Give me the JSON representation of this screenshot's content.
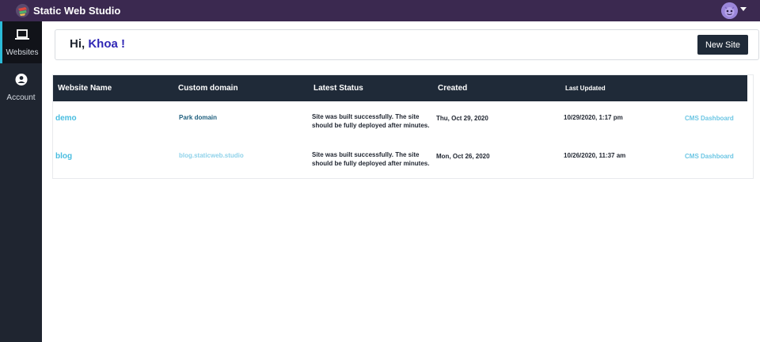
{
  "app": {
    "title": "Static Web Studio"
  },
  "sidebar": {
    "items": [
      {
        "label": "Websites",
        "icon": "laptop-icon",
        "active": true
      },
      {
        "label": "Account",
        "icon": "account-circle-icon",
        "active": false
      }
    ]
  },
  "greeting": {
    "prefix": "Hi,",
    "name": "Khoa !"
  },
  "actions": {
    "new_site": "New Site"
  },
  "table": {
    "headers": {
      "name": "Website Name",
      "domain": "Custom domain",
      "status": "Latest Status",
      "created": "Created",
      "updated": "Last Updated"
    },
    "rows": [
      {
        "name": "demo",
        "domain": "Park domain",
        "status": "Site was built successfully. The site should be fully deployed after minutes.",
        "created": "Thu, Oct 29, 2020",
        "updated": "10/29/2020, 1:17 pm",
        "cms": "CMS Dashboard"
      },
      {
        "name": "blog",
        "domain": "blog.staticweb.studio",
        "status": "Site was built successfully. The site should be fully deployed after minutes.",
        "created": "Mon, Oct 26, 2020",
        "updated": "10/26/2020, 11:37 am",
        "cms": "CMS Dashboard"
      }
    ]
  },
  "colors": {
    "topbar": "#3b2950",
    "sidebar": "#1f2530",
    "table_header": "#1f2a38",
    "accent_link": "#49bde0",
    "greeting_name": "#3027b5"
  }
}
